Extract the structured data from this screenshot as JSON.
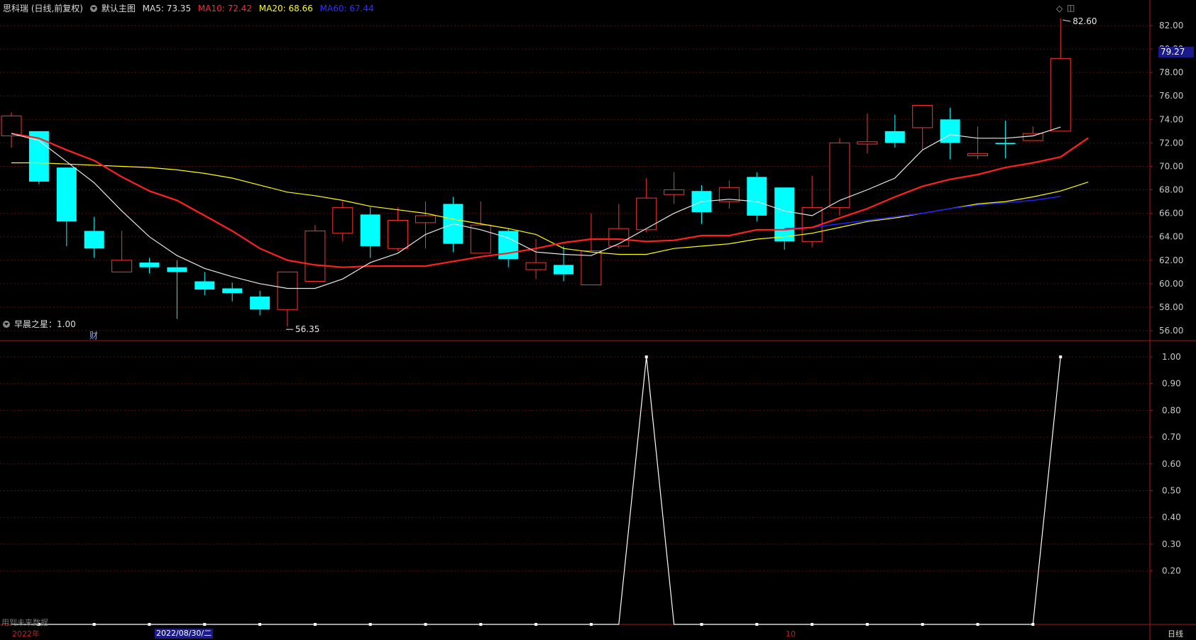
{
  "header": {
    "stock_title": "思科瑞 (日线,前复权)",
    "indicator_name": "默认主图",
    "ma5": "MA5: 73.35",
    "ma10": "MA10: 72.42",
    "ma20": "MA20: 68.66",
    "ma60": "MA60: 67.44",
    "colors": {
      "ma5": "#ffffff",
      "ma10": "#ff2020",
      "ma20": "#ffff00",
      "ma60": "#2020ff"
    }
  },
  "price_axis": {
    "ticks": [
      "82.00",
      "80.00",
      "78.00",
      "76.00",
      "74.00",
      "72.00",
      "70.00",
      "68.00",
      "66.00",
      "64.00",
      "62.00",
      "60.00",
      "58.00",
      "56.00"
    ],
    "current_price": "79.27",
    "high_label": "82.60",
    "low_label": "56.35",
    "fin_marker": "财"
  },
  "indicator_panel": {
    "title": "早晨之星：1.00",
    "ticks": [
      "1.00",
      "0.90",
      "0.80",
      "0.70",
      "0.60",
      "0.50",
      "0.40",
      "0.30",
      "0.20"
    ],
    "footer_note": "用到未来数据"
  },
  "time_axis": {
    "year_label": "2022年",
    "selected_date": "2022/08/30/二",
    "month_label": "10",
    "period_label": "日线"
  },
  "chart_data": {
    "type": "candlestick",
    "ylim": [
      55.4,
      82.9
    ],
    "candles": [
      {
        "o": 72.6,
        "c": 74.3,
        "h": 74.6,
        "l": 71.6
      },
      {
        "o": 73.0,
        "c": 68.7,
        "h": 73.0,
        "l": 68.5
      },
      {
        "o": 69.9,
        "c": 65.3,
        "h": 69.9,
        "l": 63.2
      },
      {
        "o": 64.5,
        "c": 63.0,
        "h": 65.7,
        "l": 62.2
      },
      {
        "o": 61.0,
        "c": 62.0,
        "h": 64.5,
        "l": 61.0
      },
      {
        "o": 61.8,
        "c": 61.4,
        "h": 62.2,
        "l": 60.9
      },
      {
        "o": 61.4,
        "c": 61.0,
        "h": 62.0,
        "l": 57.0
      },
      {
        "o": 60.2,
        "c": 59.5,
        "h": 61.0,
        "l": 59.0
      },
      {
        "o": 59.6,
        "c": 59.2,
        "h": 60.1,
        "l": 58.5
      },
      {
        "o": 58.9,
        "c": 57.8,
        "h": 59.4,
        "l": 57.3
      },
      {
        "o": 57.8,
        "c": 61.0,
        "h": 61.0,
        "l": 56.35
      },
      {
        "o": 60.2,
        "c": 64.5,
        "h": 65.0,
        "l": 60.2
      },
      {
        "o": 64.3,
        "c": 66.5,
        "h": 67.0,
        "l": 63.6
      },
      {
        "o": 65.9,
        "c": 63.2,
        "h": 66.5,
        "l": 62.2
      },
      {
        "o": 63.0,
        "c": 65.4,
        "h": 66.5,
        "l": 62.8
      },
      {
        "o": 65.2,
        "c": 65.8,
        "h": 67.0,
        "l": 63.0
      },
      {
        "o": 66.8,
        "c": 63.4,
        "h": 67.4,
        "l": 62.7
      },
      {
        "o": 62.6,
        "c": 65.0,
        "h": 67.0,
        "l": 62.6
      },
      {
        "o": 64.5,
        "c": 62.1,
        "h": 64.7,
        "l": 61.4
      },
      {
        "o": 61.2,
        "c": 61.8,
        "h": 63.8,
        "l": 60.4
      },
      {
        "o": 61.6,
        "c": 60.8,
        "h": 63.2,
        "l": 60.2
      },
      {
        "o": 59.9,
        "c": 62.8,
        "h": 66.0,
        "l": 59.9
      },
      {
        "o": 63.2,
        "c": 64.7,
        "h": 66.8,
        "l": 63.0
      },
      {
        "o": 64.6,
        "c": 67.3,
        "h": 69.0,
        "l": 64.4
      },
      {
        "o": 67.6,
        "c": 68.0,
        "h": 69.5,
        "l": 66.8
      },
      {
        "o": 67.9,
        "c": 66.1,
        "h": 68.4,
        "l": 65.1
      },
      {
        "o": 67.0,
        "c": 68.2,
        "h": 68.8,
        "l": 66.4
      },
      {
        "o": 69.1,
        "c": 65.8,
        "h": 69.5,
        "l": 65.3
      },
      {
        "o": 68.2,
        "c": 63.6,
        "h": 68.2,
        "l": 62.9
      },
      {
        "o": 63.6,
        "c": 66.5,
        "h": 69.2,
        "l": 63.1
      },
      {
        "o": 66.5,
        "c": 72.0,
        "h": 72.4,
        "l": 65.8
      },
      {
        "o": 71.9,
        "c": 72.1,
        "h": 74.5,
        "l": 71.1
      },
      {
        "o": 73.0,
        "c": 72.0,
        "h": 74.4,
        "l": 71.6
      },
      {
        "o": 73.3,
        "c": 75.2,
        "h": 75.2,
        "l": 71.4
      },
      {
        "o": 74.0,
        "c": 72.0,
        "h": 75.0,
        "l": 70.6
      },
      {
        "o": 70.9,
        "c": 71.1,
        "h": 73.4,
        "l": 70.6
      },
      {
        "o": 72.0,
        "c": 71.9,
        "h": 73.9,
        "l": 70.7
      },
      {
        "o": 72.2,
        "c": 72.8,
        "h": 73.4,
        "l": 72.2
      },
      {
        "o": 73.0,
        "c": 79.2,
        "h": 82.6,
        "l": 73.0
      }
    ],
    "ma5": [
      72.8,
      72.2,
      70.4,
      68.6,
      66.2,
      64.0,
      62.4,
      61.3,
      60.6,
      60.0,
      59.6,
      59.6,
      60.4,
      61.8,
      62.6,
      64.2,
      65.1,
      64.6,
      63.9,
      62.7,
      62.5,
      62.4,
      63.4,
      64.7,
      66.0,
      67.0,
      67.2,
      67.0,
      66.2,
      65.8,
      67.1,
      68.0,
      69.0,
      71.4,
      72.7,
      72.4,
      72.4,
      72.6,
      73.35
    ],
    "ma10": [
      72.8,
      72.4,
      71.4,
      70.5,
      69.1,
      67.9,
      67.1,
      65.8,
      64.5,
      63.0,
      62.0,
      61.6,
      61.4,
      61.5,
      61.5,
      61.5,
      61.9,
      62.3,
      62.6,
      63.0,
      63.5,
      63.8,
      63.8,
      63.6,
      63.7,
      64.1,
      64.1,
      64.6,
      64.6,
      64.8,
      65.6,
      66.4,
      67.4,
      68.3,
      68.9,
      69.3,
      69.9,
      70.3,
      70.8,
      72.42
    ],
    "ma20": [
      70.3,
      70.3,
      70.2,
      70.1,
      70.0,
      69.9,
      69.7,
      69.4,
      69.0,
      68.4,
      67.8,
      67.5,
      67.1,
      66.6,
      66.3,
      66.0,
      65.5,
      65.1,
      64.7,
      64.2,
      63.0,
      62.7,
      62.5,
      62.5,
      63.0,
      63.2,
      63.4,
      63.8,
      64.0,
      64.3,
      64.8,
      65.3,
      65.6,
      66.0,
      66.4,
      66.8,
      67.0,
      67.4,
      67.9,
      68.66
    ],
    "ma60": [
      64.7,
      64.8,
      65.1,
      65.4,
      65.7,
      66.0,
      66.4,
      66.7,
      66.9,
      67.1,
      67.44
    ],
    "indicator": [
      0,
      0,
      0,
      0,
      0,
      0,
      0,
      0,
      0,
      0,
      0,
      0,
      0,
      0,
      0,
      0,
      0,
      0,
      0,
      0,
      0,
      0,
      0,
      1,
      0,
      0,
      0,
      0,
      0,
      0,
      0,
      0,
      0,
      0,
      0,
      0,
      0,
      0,
      1
    ]
  }
}
